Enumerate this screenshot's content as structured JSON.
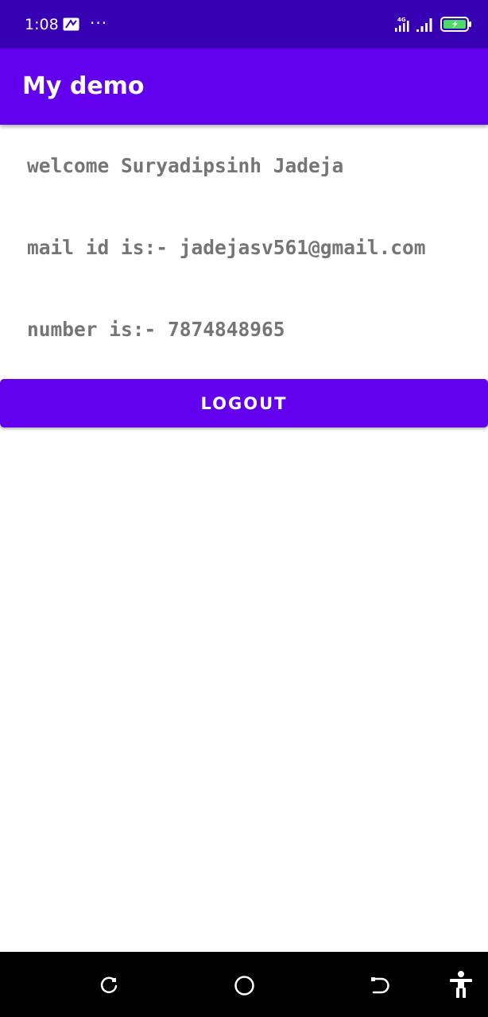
{
  "status_bar": {
    "time": "1:08",
    "more": "···",
    "network": "4G"
  },
  "app_bar": {
    "title": "My demo"
  },
  "profile": {
    "welcome": "welcome Suryadipsinh Jadeja",
    "mail": "mail id is:- jadejasv561@gmail.com",
    "number": "number is:- 7874848965"
  },
  "actions": {
    "logout_label": "LOGOUT"
  },
  "colors": {
    "status_bar": "#3700b3",
    "primary": "#6200ee",
    "text_gray": "#757575",
    "battery_charge": "#4cd964"
  }
}
